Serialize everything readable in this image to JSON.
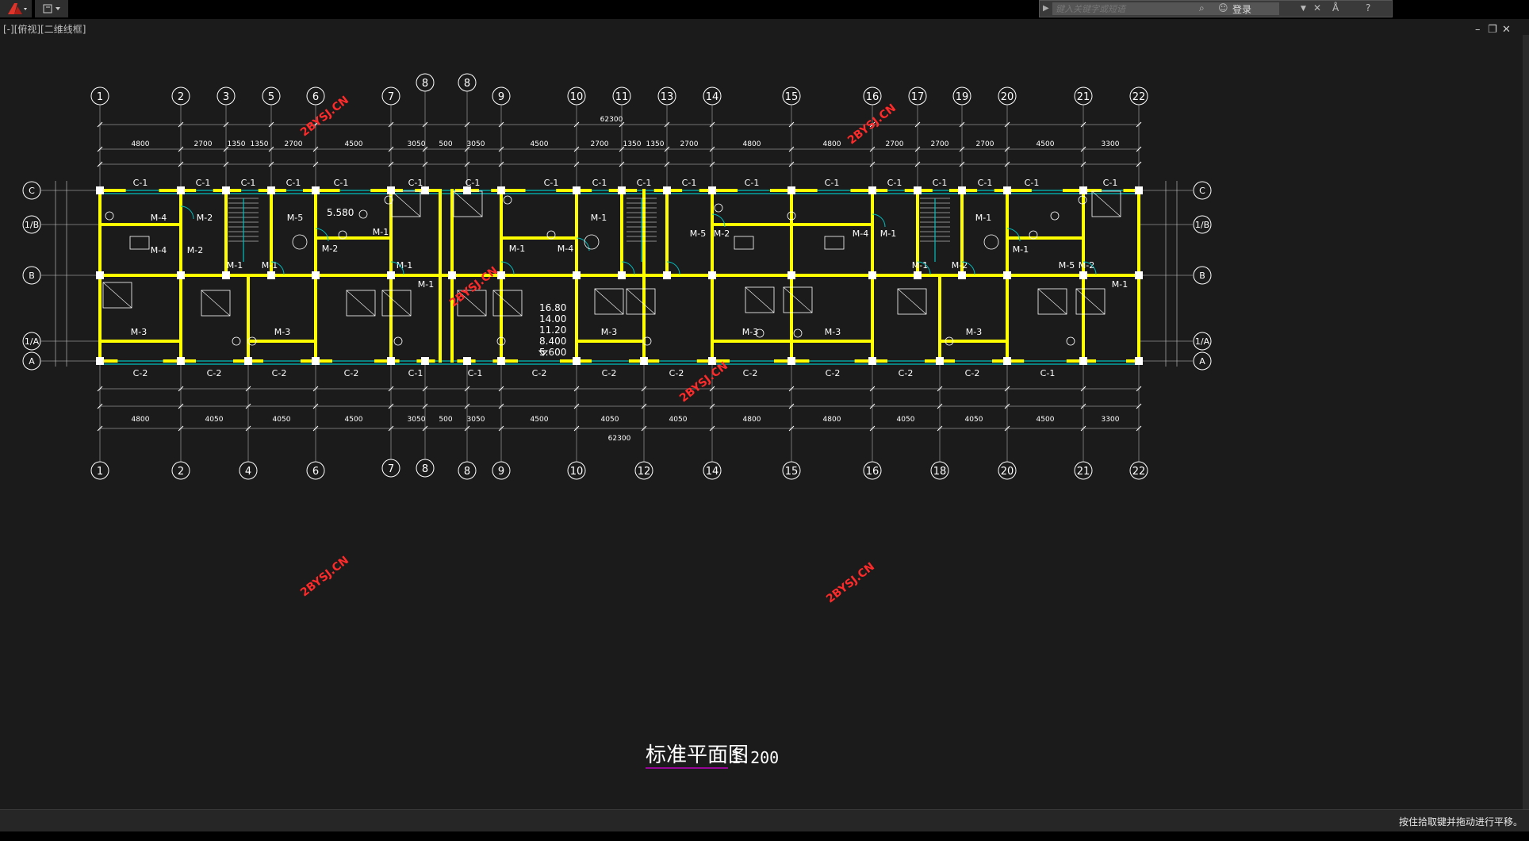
{
  "search": {
    "placeholder": "键入关键字或短语"
  },
  "user": {
    "login_label": "登录"
  },
  "viewport": {
    "label": "[-][俯视][二维线框]"
  },
  "status": {
    "message": "按住拾取键并拖动进行平移。"
  },
  "drawing": {
    "title": "标准平面图",
    "scale": "1:200",
    "watermark": "2BYSJ.CN",
    "total_dim": "62300",
    "top_axes": [
      "1",
      "2",
      "3",
      "5",
      "6",
      "7",
      "8",
      "8",
      "9",
      "10",
      "11",
      "13",
      "14",
      "15",
      "16",
      "17",
      "19",
      "20",
      "21",
      "22"
    ],
    "bottom_axes": [
      "1",
      "2",
      "4",
      "6",
      "7",
      "8",
      "8",
      "9",
      "10",
      "12",
      "14",
      "15",
      "16",
      "18",
      "20",
      "21",
      "22"
    ],
    "side_axes": [
      "C",
      "1/B",
      "B",
      "1/A",
      "A"
    ],
    "top_dims": [
      "4800",
      "2700",
      "1350",
      "1350",
      "2700",
      "4500",
      "3050",
      "500",
      "3050",
      "4500",
      "2700",
      "1350",
      "1350",
      "2700",
      "4800",
      "4800",
      "2700",
      "2700",
      "2700",
      "4500",
      "3300"
    ],
    "bottom_dims": [
      "4800",
      "4050",
      "4050",
      "4500",
      "3050",
      "500",
      "3050",
      "4500",
      "4050",
      "4050",
      "4800",
      "4800",
      "4050",
      "4050",
      "4500",
      "3300"
    ],
    "rooms_top": [
      "C-1",
      "C-1",
      "C-1",
      "C-1",
      "C-1",
      "C-1",
      "C-1",
      "C-1",
      "C-1",
      "C-1",
      "C-1",
      "C-1",
      "C-1",
      "C-1",
      "C-1",
      "C-1",
      "C-1",
      "C-1",
      "C-1",
      "C-1",
      "C-1"
    ],
    "rooms_bottom": [
      "C-2",
      "C-2",
      "C-2",
      "C-2",
      "C-1",
      "C-1",
      "C-2",
      "C-2",
      "C-2",
      "C-2",
      "C-2",
      "C-2",
      "C-2",
      "C-1"
    ],
    "door_labels": [
      "M-4",
      "M-2",
      "M-5",
      "M-2",
      "M-1",
      "M-1",
      "M-1",
      "M-1",
      "M-1",
      "M-4",
      "M-2",
      "M-5",
      "M-2",
      "M-4",
      "M-1",
      "M-1",
      "M-1",
      "M-1",
      "M-2",
      "M-5",
      "M-2",
      "M-1",
      "M-1",
      "M-4",
      "M-1"
    ],
    "m3_labels": [
      "M-3",
      "M-3",
      "M-3",
      "M-3",
      "M-3",
      "M-3"
    ],
    "elevations": [
      "16.80",
      "14.00",
      "11.20",
      "8.400",
      "5.600"
    ],
    "note_580": "5.580",
    "colors": {
      "wall": "#ffff00",
      "line": "#ffffff",
      "dim": "#cccccc",
      "accent": "#00bfbf",
      "watermark": "#ff2a2a",
      "title_underline": "#c000c0"
    }
  }
}
